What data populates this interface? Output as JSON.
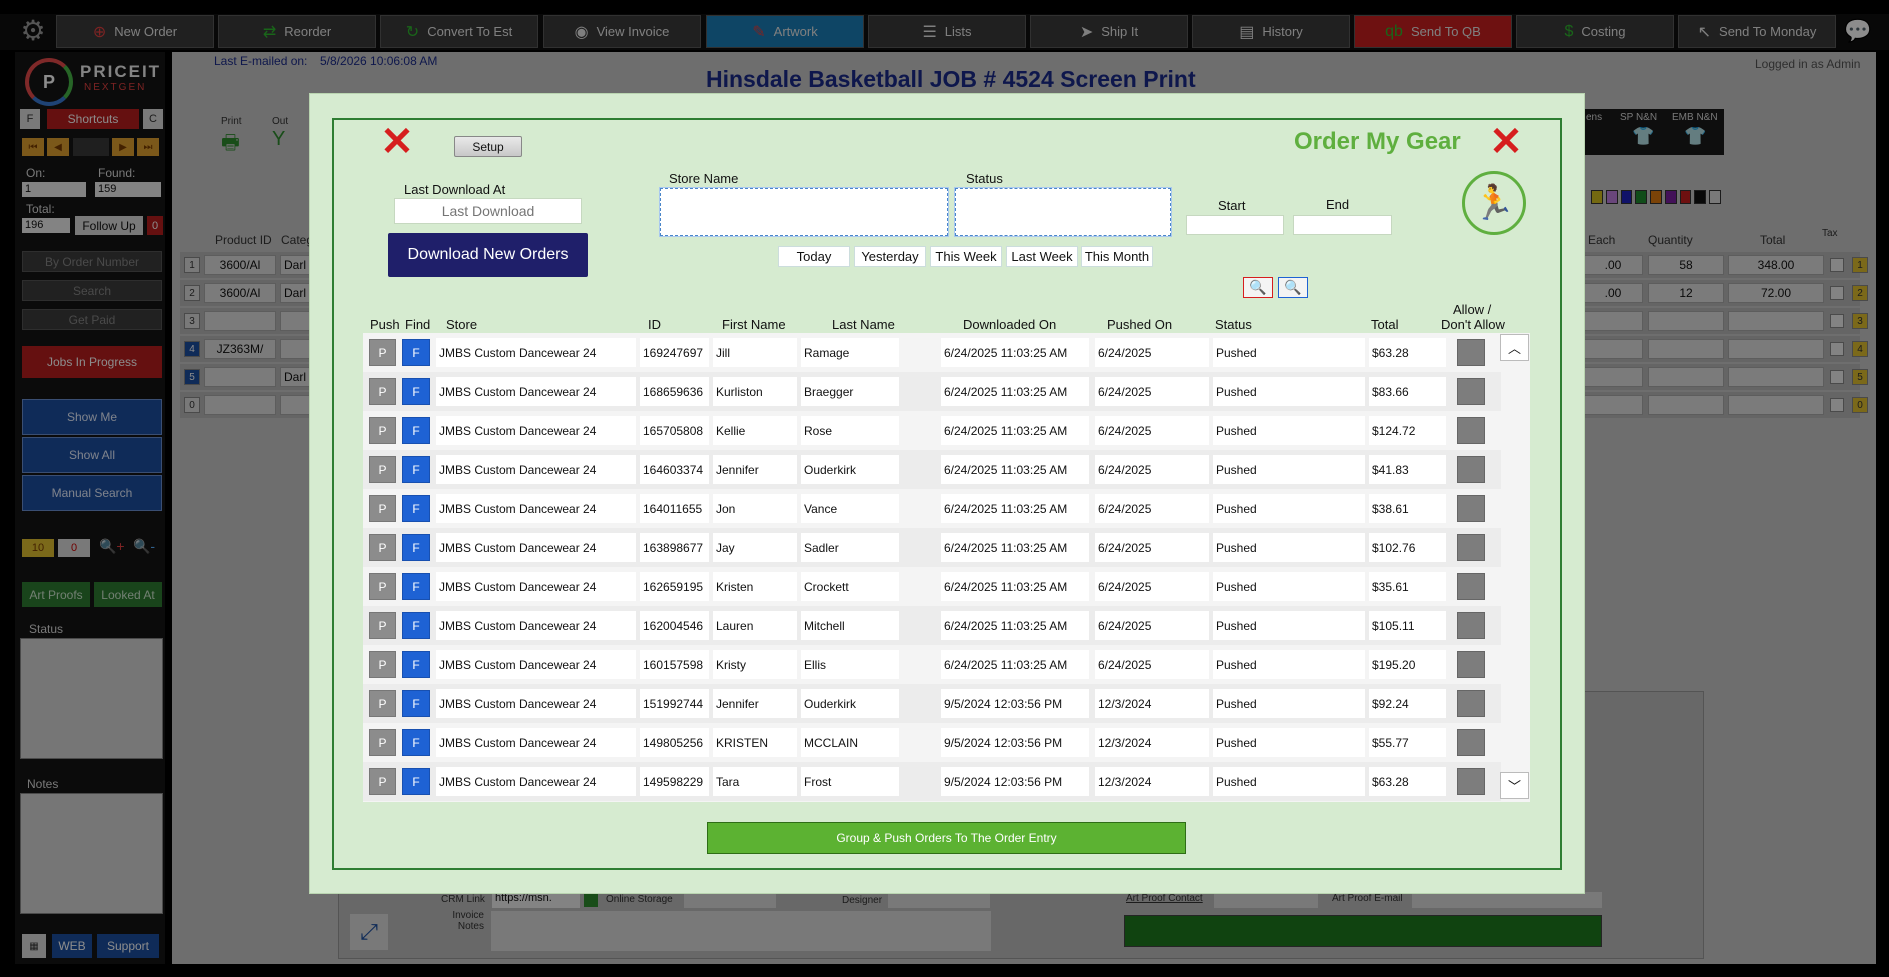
{
  "toolbar": {
    "new_order": "New Order",
    "reorder": "Reorder",
    "convert": "Convert To Est",
    "view_invoice": "View Invoice",
    "artwork": "Artwork",
    "lists": "Lists",
    "ship_it": "Ship It",
    "history": "History",
    "send_qb": "Send To QB",
    "qb_badge": "qb",
    "costing": "Costing",
    "send_monday": "Send To Monday"
  },
  "brand": {
    "name": "PRICEIT",
    "sub": "NEXTGEN",
    "mark": "P"
  },
  "sidebar": {
    "f": "F",
    "shortcuts": "Shortcuts",
    "c": "C",
    "on_label": "On:",
    "on_value": "1",
    "found_label": "Found:",
    "found_value": "159",
    "total_label": "Total:",
    "total_value": "196",
    "follow_up": "Follow Up",
    "follow_count": "0",
    "by_order": "By Order Number",
    "search": "Search",
    "get_paid": "Get Paid",
    "jobs": "Jobs In Progress",
    "show_me": "Show Me",
    "show_all": "Show All",
    "manual_search": "Manual Search",
    "count_a": "10",
    "count_b": "0",
    "art_proofs": "Art Proofs",
    "looked_at": "Looked At",
    "status": "Status",
    "notes": "Notes",
    "web": "WEB",
    "support": "Support"
  },
  "background": {
    "last_emailed_label": "Last E-mailed on:",
    "last_emailed_value": "5/8/2026 10:06:08 AM",
    "job_title": "Hinsdale Basketball   JOB # 4524   Screen Print",
    "logged_in": "Logged in as Admin",
    "print": "Print",
    "out": "Out",
    "product_id": "Product ID",
    "category": "Categ",
    "each": "Each",
    "quantity": "Quantity",
    "total": "Total",
    "tax": "Tax",
    "rows": [
      {
        "num": "1",
        "pid": "3600/Al",
        "cat": "Darl",
        "each": ".00",
        "qty": "58",
        "total": "348.00",
        "tag": "1"
      },
      {
        "num": "2",
        "pid": "3600/Al",
        "cat": "Darl",
        "each": ".00",
        "qty": "12",
        "total": "72.00",
        "tag": "2"
      },
      {
        "num": "3",
        "pid": "",
        "cat": "",
        "each": "",
        "qty": "",
        "total": "",
        "tag": "3"
      },
      {
        "num": "4",
        "pid": "JZ363M/",
        "cat": "",
        "each": "",
        "qty": "",
        "total": "",
        "tag": "4"
      },
      {
        "num": "5",
        "pid": "",
        "cat": "Darl",
        "each": "",
        "qty": "",
        "total": "",
        "tag": "5"
      },
      {
        "num": "0",
        "pid": "",
        "cat": "",
        "each": "",
        "qty": "",
        "total": "",
        "tag": "0"
      }
    ],
    "sp_nn": "SP N&N",
    "emb_nn": "EMB N&N",
    "ens": "ens",
    "crm_link": "CRM Link",
    "crm_value": "https://msn.",
    "online_storage": "Online Storage",
    "designer": "Designer",
    "invoice_notes": "Invoice Notes",
    "art_proof_contact": "Art Proof Contact",
    "art_proof_email": "Art Proof E-mail"
  },
  "modal": {
    "title": "Order My Gear",
    "setup": "Setup",
    "last_download_label": "Last Download At",
    "last_download_placeholder": "Last Download",
    "download_btn": "Download New Orders",
    "store_name_label": "Store Name",
    "status_label": "Status",
    "start_label": "Start",
    "end_label": "End",
    "ranges": [
      "Today",
      "Yesterday",
      "This Week",
      "Last Week",
      "This Month"
    ],
    "columns": {
      "push": "Push",
      "find": "Find",
      "store": "Store",
      "id": "ID",
      "first": "First Name",
      "last": "Last Name",
      "downloaded": "Downloaded On",
      "pushed": "Pushed On",
      "status": "Status",
      "total": "Total",
      "allow": "Allow /",
      "allow2": "Don't Allow"
    },
    "p_label": "P",
    "f_label": "F",
    "rows": [
      {
        "store": "JMBS Custom Dancewear 24",
        "id": "169247697",
        "first": "Jill",
        "last": "Ramage",
        "downloaded": "6/24/2025 11:03:25 AM",
        "pushed": "6/24/2025",
        "status": "Pushed",
        "total": "$63.28"
      },
      {
        "store": "JMBS Custom Dancewear 24",
        "id": "168659636",
        "first": "Kurliston",
        "last": "Braegger",
        "downloaded": "6/24/2025 11:03:25 AM",
        "pushed": "6/24/2025",
        "status": "Pushed",
        "total": "$83.66"
      },
      {
        "store": "JMBS Custom Dancewear 24",
        "id": "165705808",
        "first": "Kellie",
        "last": "Rose",
        "downloaded": "6/24/2025 11:03:25 AM",
        "pushed": "6/24/2025",
        "status": "Pushed",
        "total": "$124.72"
      },
      {
        "store": "JMBS Custom Dancewear 24",
        "id": "164603374",
        "first": "Jennifer",
        "last": "Ouderkirk",
        "downloaded": "6/24/2025 11:03:25 AM",
        "pushed": "6/24/2025",
        "status": "Pushed",
        "total": "$41.83"
      },
      {
        "store": "JMBS Custom Dancewear 24",
        "id": "164011655",
        "first": "Jon",
        "last": "Vance",
        "downloaded": "6/24/2025 11:03:25 AM",
        "pushed": "6/24/2025",
        "status": "Pushed",
        "total": "$38.61"
      },
      {
        "store": "JMBS Custom Dancewear 24",
        "id": "163898677",
        "first": "Jay",
        "last": "Sadler",
        "downloaded": "6/24/2025 11:03:25 AM",
        "pushed": "6/24/2025",
        "status": "Pushed",
        "total": "$102.76"
      },
      {
        "store": "JMBS Custom Dancewear 24",
        "id": "162659195",
        "first": "Kristen",
        "last": "Crockett",
        "downloaded": "6/24/2025 11:03:25 AM",
        "pushed": "6/24/2025",
        "status": "Pushed",
        "total": "$35.61"
      },
      {
        "store": "JMBS Custom Dancewear 24",
        "id": "162004546",
        "first": "Lauren",
        "last": "Mitchell",
        "downloaded": "6/24/2025 11:03:25 AM",
        "pushed": "6/24/2025",
        "status": "Pushed",
        "total": "$105.11"
      },
      {
        "store": "JMBS Custom Dancewear 24",
        "id": "160157598",
        "first": "Kristy",
        "last": "Ellis",
        "downloaded": "6/24/2025 11:03:25 AM",
        "pushed": "6/24/2025",
        "status": "Pushed",
        "total": "$195.20"
      },
      {
        "store": "JMBS Custom Dancewear 24",
        "id": "151992744",
        "first": "Jennifer",
        "last": "Ouderkirk",
        "downloaded": "9/5/2024 12:03:56 PM",
        "pushed": "12/3/2024",
        "status": "Pushed",
        "total": "$92.24"
      },
      {
        "store": "JMBS Custom Dancewear 24",
        "id": "149805256",
        "first": "KRISTEN",
        "last": "MCCLAIN",
        "downloaded": "9/5/2024 12:03:56 PM",
        "pushed": "12/3/2024",
        "status": "Pushed",
        "total": "$55.77"
      },
      {
        "store": "JMBS Custom Dancewear 24",
        "id": "149598229",
        "first": "Tara",
        "last": "Frost",
        "downloaded": "9/5/2024 12:03:56 PM",
        "pushed": "12/3/2024",
        "status": "Pushed",
        "total": "$63.28"
      }
    ],
    "push_all": "Group & Push Orders To The Order Entry"
  },
  "colors": {
    "accent_green": "#5faf3f",
    "close_red": "#d61e1e",
    "download_navy": "#1f1f6a",
    "find_blue": "#1e62d4"
  },
  "icons": [
    "gear-icon",
    "close-icon",
    "run-icon",
    "search-icon",
    "chevron-up-icon",
    "chevron-down-icon",
    "chat-icon"
  ]
}
